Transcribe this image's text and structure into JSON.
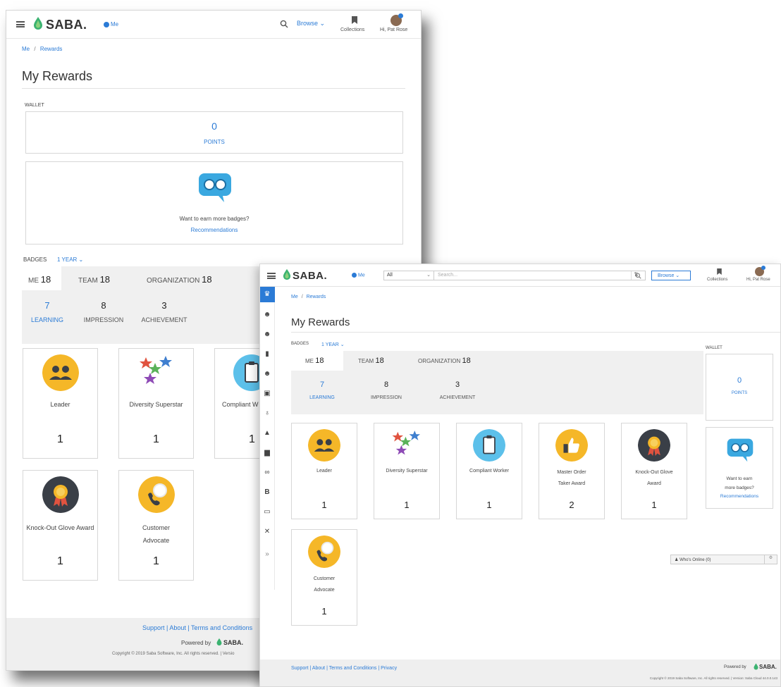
{
  "back": {
    "brand": "SABA.",
    "me_label": "Me",
    "browse_label": "Browse",
    "collections_label": "Collections",
    "user_label": "Hi, Pat Rose",
    "breadcrumb": {
      "me": "Me",
      "sep": "/",
      "current": "Rewards"
    },
    "page_title": "My Rewards",
    "wallet_label": "WALLET",
    "points_value": "0",
    "points_label": "POINTS",
    "earn_text": "Want to earn more badges?",
    "recommendations": "Recommendations",
    "badges_label": "BADGES",
    "period": "1 YEAR",
    "tabs": [
      {
        "label": "ME",
        "count": "18"
      },
      {
        "label": "TEAM",
        "count": "18"
      },
      {
        "label": "ORGANIZATION",
        "count": "18"
      }
    ],
    "subtabs": [
      {
        "num": "7",
        "label": "LEARNING"
      },
      {
        "num": "8",
        "label": "IMPRESSION"
      },
      {
        "num": "3",
        "label": "ACHIEVEMENT"
      }
    ],
    "badges": [
      {
        "name": "Leader",
        "count": "1",
        "icon": "leader-icon"
      },
      {
        "name": "Diversity Superstar",
        "count": "1",
        "icon": "stars-icon"
      },
      {
        "name": "Compliant W",
        "count": "1",
        "icon": "clipboard-icon"
      },
      {
        "name": "Knock-Out Glove Award",
        "count": "1",
        "icon": "medal-icon"
      },
      {
        "name": "Customer Advocate",
        "count": "1",
        "icon": "phone-icon"
      }
    ],
    "footer_links": "Support | About | Terms and Conditions",
    "powered_by": "Powered by",
    "copyright": "Copyright © 2019 Saba Software, Inc. All rights reserved. | Versio"
  },
  "front": {
    "brand": "SABA.",
    "me_label": "Me",
    "scope_select": "All",
    "search_placeholder": "Search...",
    "browse_label": "Browse",
    "collections_label": "Collections",
    "user_label": "Hi, Pat Rose",
    "breadcrumb": {
      "me": "Me",
      "sep": "/",
      "current": "Rewards"
    },
    "page_title": "My Rewards",
    "badges_label": "BADGES",
    "period": "1 YEAR",
    "tabs": [
      {
        "label": "ME",
        "count": "18"
      },
      {
        "label": "TEAM",
        "count": "18"
      },
      {
        "label": "ORGANIZATION",
        "count": "18"
      }
    ],
    "subtabs": [
      {
        "num": "7",
        "label": "LEARNING"
      },
      {
        "num": "8",
        "label": "IMPRESSION"
      },
      {
        "num": "3",
        "label": "ACHIEVEMENT"
      }
    ],
    "badges": [
      {
        "name": "Leader",
        "count": "1",
        "icon": "leader-icon"
      },
      {
        "name": "Diversity Superstar",
        "count": "1",
        "icon": "stars-icon"
      },
      {
        "name": "Compliant Worker",
        "count": "1",
        "icon": "clipboard-icon"
      },
      {
        "name_l1": "Master Order",
        "name_l2": "Taker Award",
        "count": "2",
        "icon": "thumbs-up-icon"
      },
      {
        "name_l1": "Knock-Out Glove",
        "name_l2": "Award",
        "count": "1",
        "icon": "medal-icon"
      },
      {
        "name_l1": "Customer",
        "name_l2": "Advocate",
        "count": "1",
        "icon": "phone-icon"
      }
    ],
    "wallet_label": "WALLET",
    "points_value": "0",
    "points_label": "POINTS",
    "earn_text_l1": "Want to earn",
    "earn_text_l2": "more badges?",
    "recommendations": "Recommendations",
    "whos_online": "Who's Online (0)",
    "footer_links": "Support | About | Terms and Conditions | Privacy",
    "powered_by": "Powered by",
    "copyright": "Copyright © 2019 Saba Software, Inc. All rights reserved. | Version: Saba Cloud 44.0.0.143"
  },
  "colors": {
    "accent": "#2b7bd6",
    "brand_green": "#3cb371",
    "badge_yellow": "#f5b728",
    "badge_dark": "#3a3f47",
    "robot_blue": "#3aa8e0"
  }
}
